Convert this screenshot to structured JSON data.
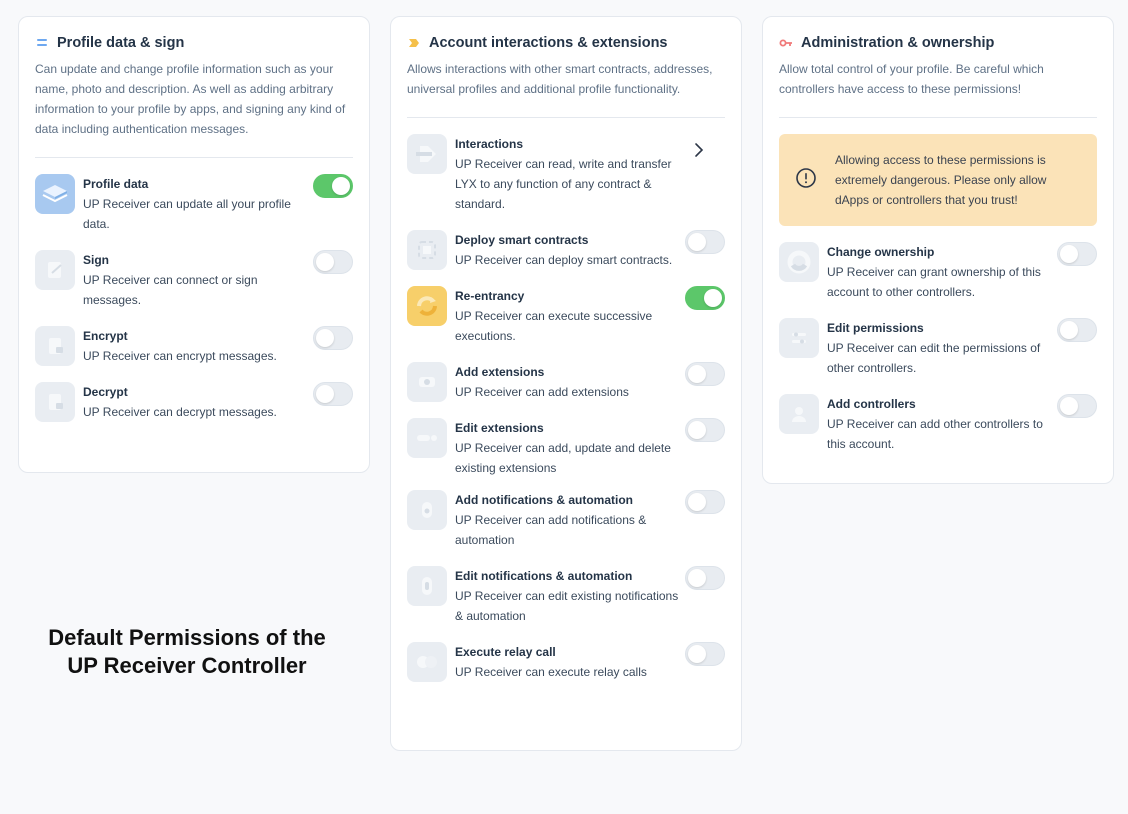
{
  "columns": [
    {
      "title": "Profile data & sign",
      "description": "Can update and change profile information such as your name, photo and description. As well as adding arbitrary information to your profile by apps, and signing any kind of data including authentication messages.",
      "permissions": [
        {
          "title": "Profile data",
          "desc": "UP Receiver can update all your profile data.",
          "enabled": true
        },
        {
          "title": "Sign",
          "desc": "UP Receiver can connect or sign messages.",
          "enabled": false
        },
        {
          "title": "Encrypt",
          "desc": "UP Receiver can encrypt messages.",
          "enabled": false
        },
        {
          "title": "Decrypt",
          "desc": "UP Receiver can decrypt messages.",
          "enabled": false
        }
      ]
    },
    {
      "title": "Account interactions & extensions",
      "description": "Allows interactions with other smart contracts, addresses, universal profiles and additional profile functionality.",
      "permissions": [
        {
          "title": "Interactions",
          "desc": "UP Receiver can read, write and transfer LYX to any function of any contract & standard.",
          "control": "chevron"
        },
        {
          "title": "Deploy smart contracts",
          "desc": "UP Receiver can deploy smart contracts.",
          "enabled": false
        },
        {
          "title": "Re-entrancy",
          "desc": "UP Receiver can execute successive executions.",
          "enabled": true
        },
        {
          "title": "Add extensions",
          "desc": "UP Receiver can add extensions",
          "enabled": false
        },
        {
          "title": "Edit extensions",
          "desc": "UP Receiver can add, update and delete existing extensions",
          "enabled": false
        },
        {
          "title": "Add notifications & automation",
          "desc": "UP Receiver can add notifications & automation",
          "enabled": false
        },
        {
          "title": "Edit notifications & automation",
          "desc": "UP Receiver can edit existing notifications & automation",
          "enabled": false
        },
        {
          "title": "Execute relay call",
          "desc": "UP Receiver can execute relay calls",
          "enabled": false
        }
      ]
    },
    {
      "title": "Administration & ownership",
      "description": "Allow total control of your profile. Be careful which controllers have access to these permissions!",
      "warning": "Allowing access to these permissions is extremely dangerous. Please only allow dApps or controllers that you trust!",
      "permissions": [
        {
          "title": "Change ownership",
          "desc": "UP Receiver can grant ownership of this account to other controllers.",
          "enabled": false
        },
        {
          "title": "Edit permissions",
          "desc": "UP Receiver can edit the permissions of other controllers.",
          "enabled": false
        },
        {
          "title": "Add controllers",
          "desc": "UP Receiver can add other controllers to this account.",
          "enabled": false
        }
      ]
    }
  ],
  "caption": {
    "line1": "Default Permissions of the",
    "line2": "UP Receiver Controller"
  },
  "colors": {
    "toggle_on": "#5cc76a",
    "warning_bg": "#fbe3b8",
    "header_icon_col1": "#6ea8f0",
    "header_icon_col2": "#f5c04a",
    "header_icon_col3": "#f07a7a"
  }
}
